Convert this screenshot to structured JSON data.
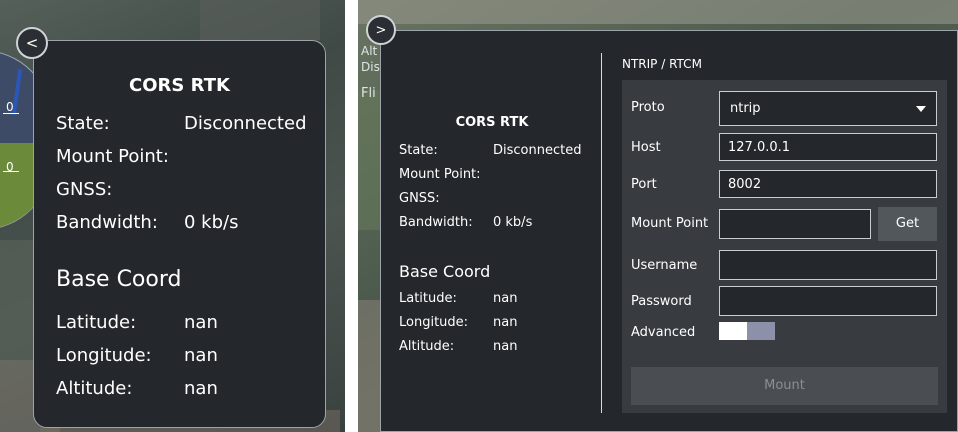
{
  "left": {
    "toggle_label": "<",
    "compass_labels": [
      "0",
      "0"
    ],
    "title": "CORS RTK",
    "state_label": "State:",
    "state_value": "Disconnected",
    "mount_point_label": "Mount Point:",
    "gnss_label": "GNSS:",
    "bandwidth_label": "Bandwidth:",
    "bandwidth_value": "0 kb/s",
    "base_coord_title": "Base Coord",
    "latitude_label": "Latitude:",
    "latitude_value": "nan",
    "longitude_label": "Longitude:",
    "longitude_value": "nan",
    "altitude_label": "Altitude:",
    "altitude_value": "nan"
  },
  "right": {
    "toggle_label": ">",
    "map_labels": [
      "Alt",
      "Dis",
      "Fli"
    ],
    "title": "CORS RTK",
    "state_label": "State:",
    "state_value": "Disconnected",
    "mount_point_label": "Mount Point:",
    "gnss_label": "GNSS:",
    "bandwidth_label": "Bandwidth:",
    "bandwidth_value": "0 kb/s",
    "base_coord_title": "Base Coord",
    "latitude_label": "Latitude:",
    "latitude_value": "nan",
    "longitude_label": "Longitude:",
    "longitude_value": "nan",
    "altitude_label": "Altitude:",
    "altitude_value": "nan",
    "ntrip": {
      "title": "NTRIP / RTCM",
      "proto_label": "Proto",
      "proto_value": "ntrip",
      "host_label": "Host",
      "host_value": "127.0.0.1",
      "port_label": "Port",
      "port_value": "8002",
      "mount_point_label": "Mount Point",
      "mount_point_value": "",
      "get_label": "Get",
      "username_label": "Username",
      "username_value": "",
      "password_label": "Password",
      "password_value": "",
      "advanced_label": "Advanced",
      "advanced_on": false,
      "mount_label": "Mount"
    }
  },
  "colors": {
    "panel_bg": "#24272b",
    "box_bg": "#383c40",
    "accent_switch": "#8c90a8"
  }
}
